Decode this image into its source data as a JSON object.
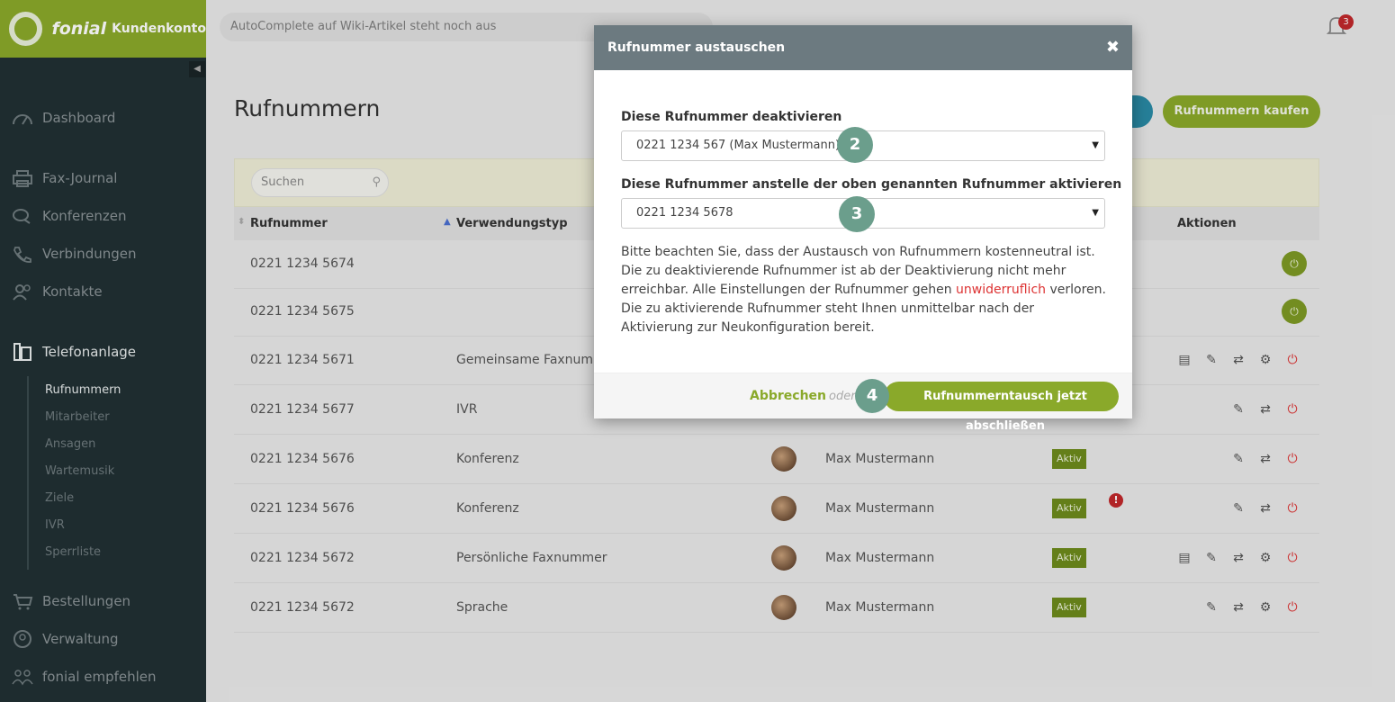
{
  "brand": {
    "name": "fonial",
    "sub": "Kundenkonto"
  },
  "topbar": {
    "search_text": "AutoComplete auf Wiki-Artikel steht noch aus",
    "notifications": "3"
  },
  "sidebar": {
    "items": [
      {
        "label": "Dashboard",
        "icon": "gauge-icon"
      },
      {
        "label": "Fax-Journal",
        "icon": "printer-icon"
      },
      {
        "label": "Konferenzen",
        "icon": "chat-icon"
      },
      {
        "label": "Verbindungen",
        "icon": "phone-icon"
      },
      {
        "label": "Kontakte",
        "icon": "contacts-icon"
      },
      {
        "label": "Telefonanlage",
        "icon": "pbx-icon"
      },
      {
        "label": "Bestellungen",
        "icon": "cart-icon"
      },
      {
        "label": "Verwaltung",
        "icon": "user-circle-icon"
      },
      {
        "label": "fonial empfehlen",
        "icon": "people-icon"
      }
    ],
    "subitems": [
      "Rufnummern",
      "Mitarbeiter",
      "Ansagen",
      "Wartemusik",
      "Ziele",
      "IVR",
      "Sperrliste"
    ]
  },
  "page": {
    "title": "Rufnummern",
    "buy_button": "Rufnummern kaufen",
    "search_placeholder": "Suchen"
  },
  "table": {
    "headers": {
      "number": "Rufnummer",
      "type": "Verwendungstyp",
      "actions": "Aktionen"
    },
    "rows": [
      {
        "number": "0221 1234 5674",
        "type": "",
        "user": "",
        "status": ""
      },
      {
        "number": "0221 1234 5675",
        "type": "",
        "user": "",
        "status": ""
      },
      {
        "number": "0221 1234 5671",
        "type": "Gemeinsame Faxnummer",
        "user": "",
        "status": ""
      },
      {
        "number": "0221 1234 5677",
        "type": "IVR",
        "user": "",
        "status": ""
      },
      {
        "number": "0221 1234 5676",
        "type": "Konferenz",
        "user": "Max Mustermann",
        "status": "Aktiv"
      },
      {
        "number": "0221 1234 5676",
        "type": "Konferenz",
        "user": "Max Mustermann",
        "status": "Aktiv"
      },
      {
        "number": "0221 1234 5672",
        "type": "Persönliche Faxnummer",
        "user": "Max Mustermann",
        "status": "Aktiv"
      },
      {
        "number": "0221 1234 5672",
        "type": "Sprache",
        "user": "Max Mustermann",
        "status": "Aktiv"
      }
    ]
  },
  "modal": {
    "title": "Rufnummer austauschen",
    "label1": "Diese Rufnummer deaktivieren",
    "select1": "0221 1234 567 (Max Mustermann)",
    "label2": "Diese Rufnummer anstelle der oben genannten Rufnummer aktivieren",
    "select2": "0221 1234 5678",
    "text_a": "Bitte beachten Sie, dass der Austausch von Rufnummern kostenneutral ist. Die zu deaktivierende Rufnummer ist ab der Deaktivierung nicht mehr erreichbar. Alle Einstellungen der Rufnummer gehen ",
    "text_red": "unwiderruflich",
    "text_b": " verloren. Die zu aktivierende Rufnummer steht Ihnen unmittelbar nach der Aktivierung zur Neukonfiguration bereit.",
    "cancel": "Abbrechen",
    "or": "oder",
    "confirm": "Rufnummerntausch jetzt abschließen",
    "steps": [
      "2",
      "3",
      "4"
    ]
  }
}
